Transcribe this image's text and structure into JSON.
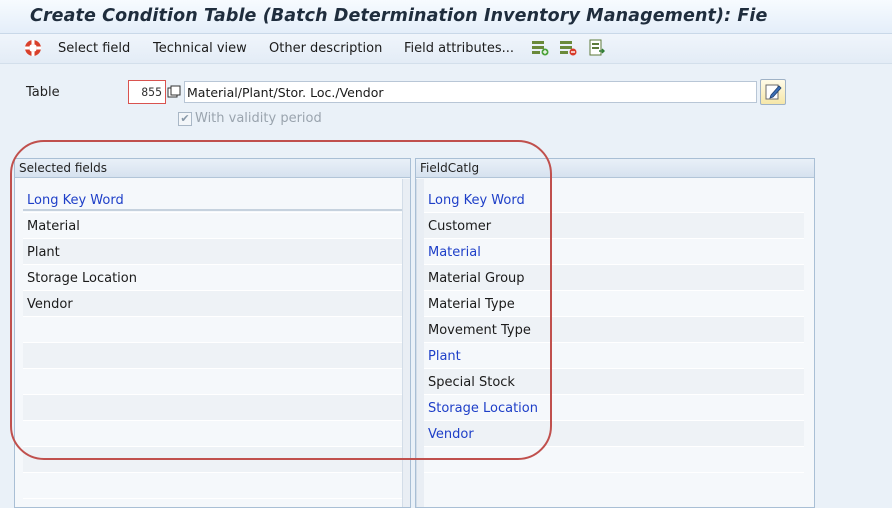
{
  "window": {
    "title": "Create Condition Table (Batch Determination Inventory Management): Fie"
  },
  "toolbar": {
    "select_field": "Select field",
    "technical_view": "Technical view",
    "other_description": "Other description",
    "field_attributes": "Field attributes..."
  },
  "form": {
    "table_label": "Table",
    "table_number": "855",
    "table_description": "Material/Plant/Stor. Loc./Vendor",
    "validity_label": "With validity period",
    "validity_checked": true
  },
  "selected_fields": {
    "header": "Selected fields",
    "column_head": "Long Key Word",
    "rows": [
      "Material",
      "Plant",
      "Storage Location",
      "Vendor"
    ]
  },
  "field_catalog": {
    "header": "FieldCatlg",
    "column_head": "Long Key Word",
    "rows": [
      {
        "label": "Customer",
        "selected": false
      },
      {
        "label": "Material",
        "selected": true
      },
      {
        "label": "Material Group",
        "selected": false
      },
      {
        "label": "Material Type",
        "selected": false
      },
      {
        "label": "Movement Type",
        "selected": false
      },
      {
        "label": "Plant",
        "selected": true
      },
      {
        "label": "Special Stock",
        "selected": false
      },
      {
        "label": "Storage Location",
        "selected": true
      },
      {
        "label": "Vendor",
        "selected": true
      }
    ]
  },
  "colors": {
    "accent_blue": "#1e3fc8",
    "annotation_red": "#c0504d"
  }
}
